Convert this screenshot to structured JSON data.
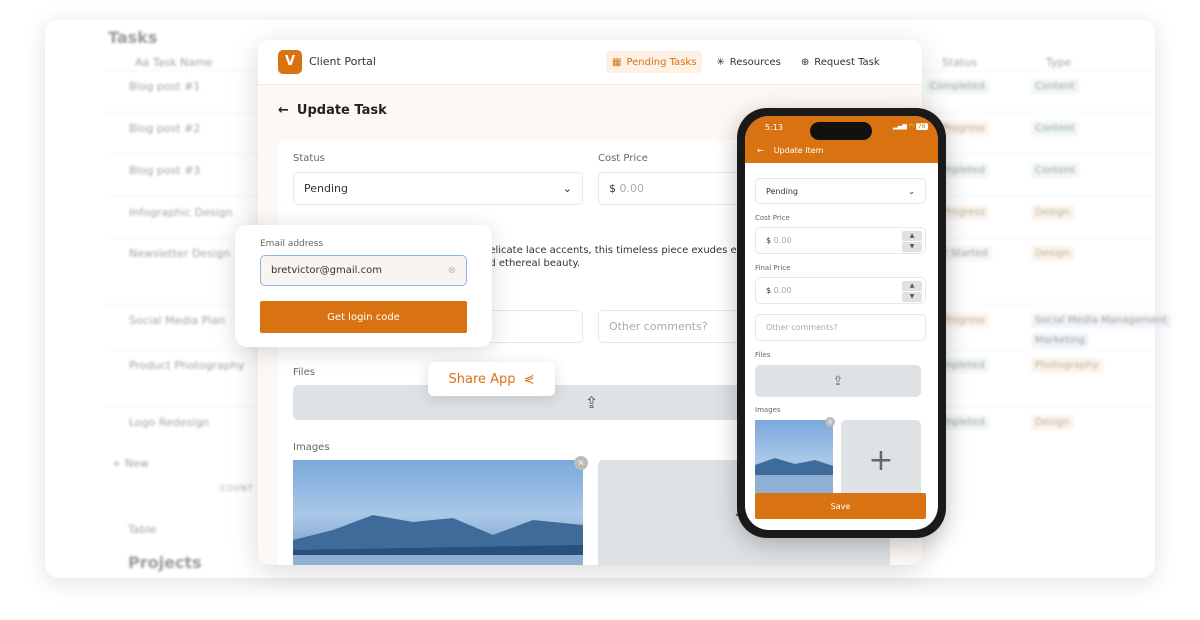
{
  "background": {
    "title": "Tasks",
    "columns": {
      "name": "Aa Task Name",
      "status": "Status",
      "type": "Type"
    },
    "rows": [
      {
        "name": "Blog post #1",
        "status": "Completed",
        "type": [
          "Content"
        ]
      },
      {
        "name": "Blog post #2",
        "status": "In Progress",
        "type": [
          "Content"
        ]
      },
      {
        "name": "Blog post #3",
        "status": "Completed",
        "type": [
          "Content"
        ]
      },
      {
        "name": "Infographic Design",
        "status": "In Progress",
        "type": [
          "Design"
        ]
      },
      {
        "name": "Newsletter Design",
        "status": "Not Started",
        "type": [
          "Design"
        ]
      },
      {
        "name": "Social Media Plan",
        "status": "In Progress",
        "type": [
          "Social Media Management",
          "Marketing"
        ]
      },
      {
        "name": "Product Photography",
        "status": "Completed",
        "type": [
          "Photography"
        ]
      },
      {
        "name": "Logo Redesign",
        "status": "Completed",
        "type": [
          "Design"
        ]
      }
    ],
    "new_label": "+ New",
    "count_label": "COUNT",
    "view_tab": "Table",
    "next_section": "Projects"
  },
  "portal": {
    "app_title": "Client Portal",
    "nav": [
      {
        "label": "Pending Tasks",
        "icon": "grid-icon",
        "active": true
      },
      {
        "label": "Resources",
        "icon": "loader-icon"
      },
      {
        "label": "Request Task",
        "icon": "plus-circle-icon"
      }
    ],
    "page_title": "Update Task",
    "status_label": "Status",
    "status_value": "Pending",
    "cost_label": "Cost Price",
    "currency": "$",
    "cost_placeholder": "0.00",
    "description_line1": "delicate lace accents, this timeless piece exudes e",
    "description_line2": "nd ethereal beauty.",
    "comments_placeholder": "Other comments?",
    "files_label": "Files",
    "images_label": "Images"
  },
  "login": {
    "email_label": "Email address",
    "email_value": "bretvictor@gmail.com",
    "button": "Get login code"
  },
  "share": {
    "label": "Share App"
  },
  "phone": {
    "time": "5:13",
    "battery": "76",
    "title": "Update Item",
    "status_value": "Pending",
    "cost_label": "Cost Price",
    "final_label": "Final Price",
    "currency": "$",
    "price_placeholder": "0.00",
    "comments_placeholder": "Other comments?",
    "files_label": "Files",
    "images_label": "Images",
    "save": "Save"
  },
  "colors": {
    "accent": "#d97312",
    "background": "#fdf8f4"
  }
}
